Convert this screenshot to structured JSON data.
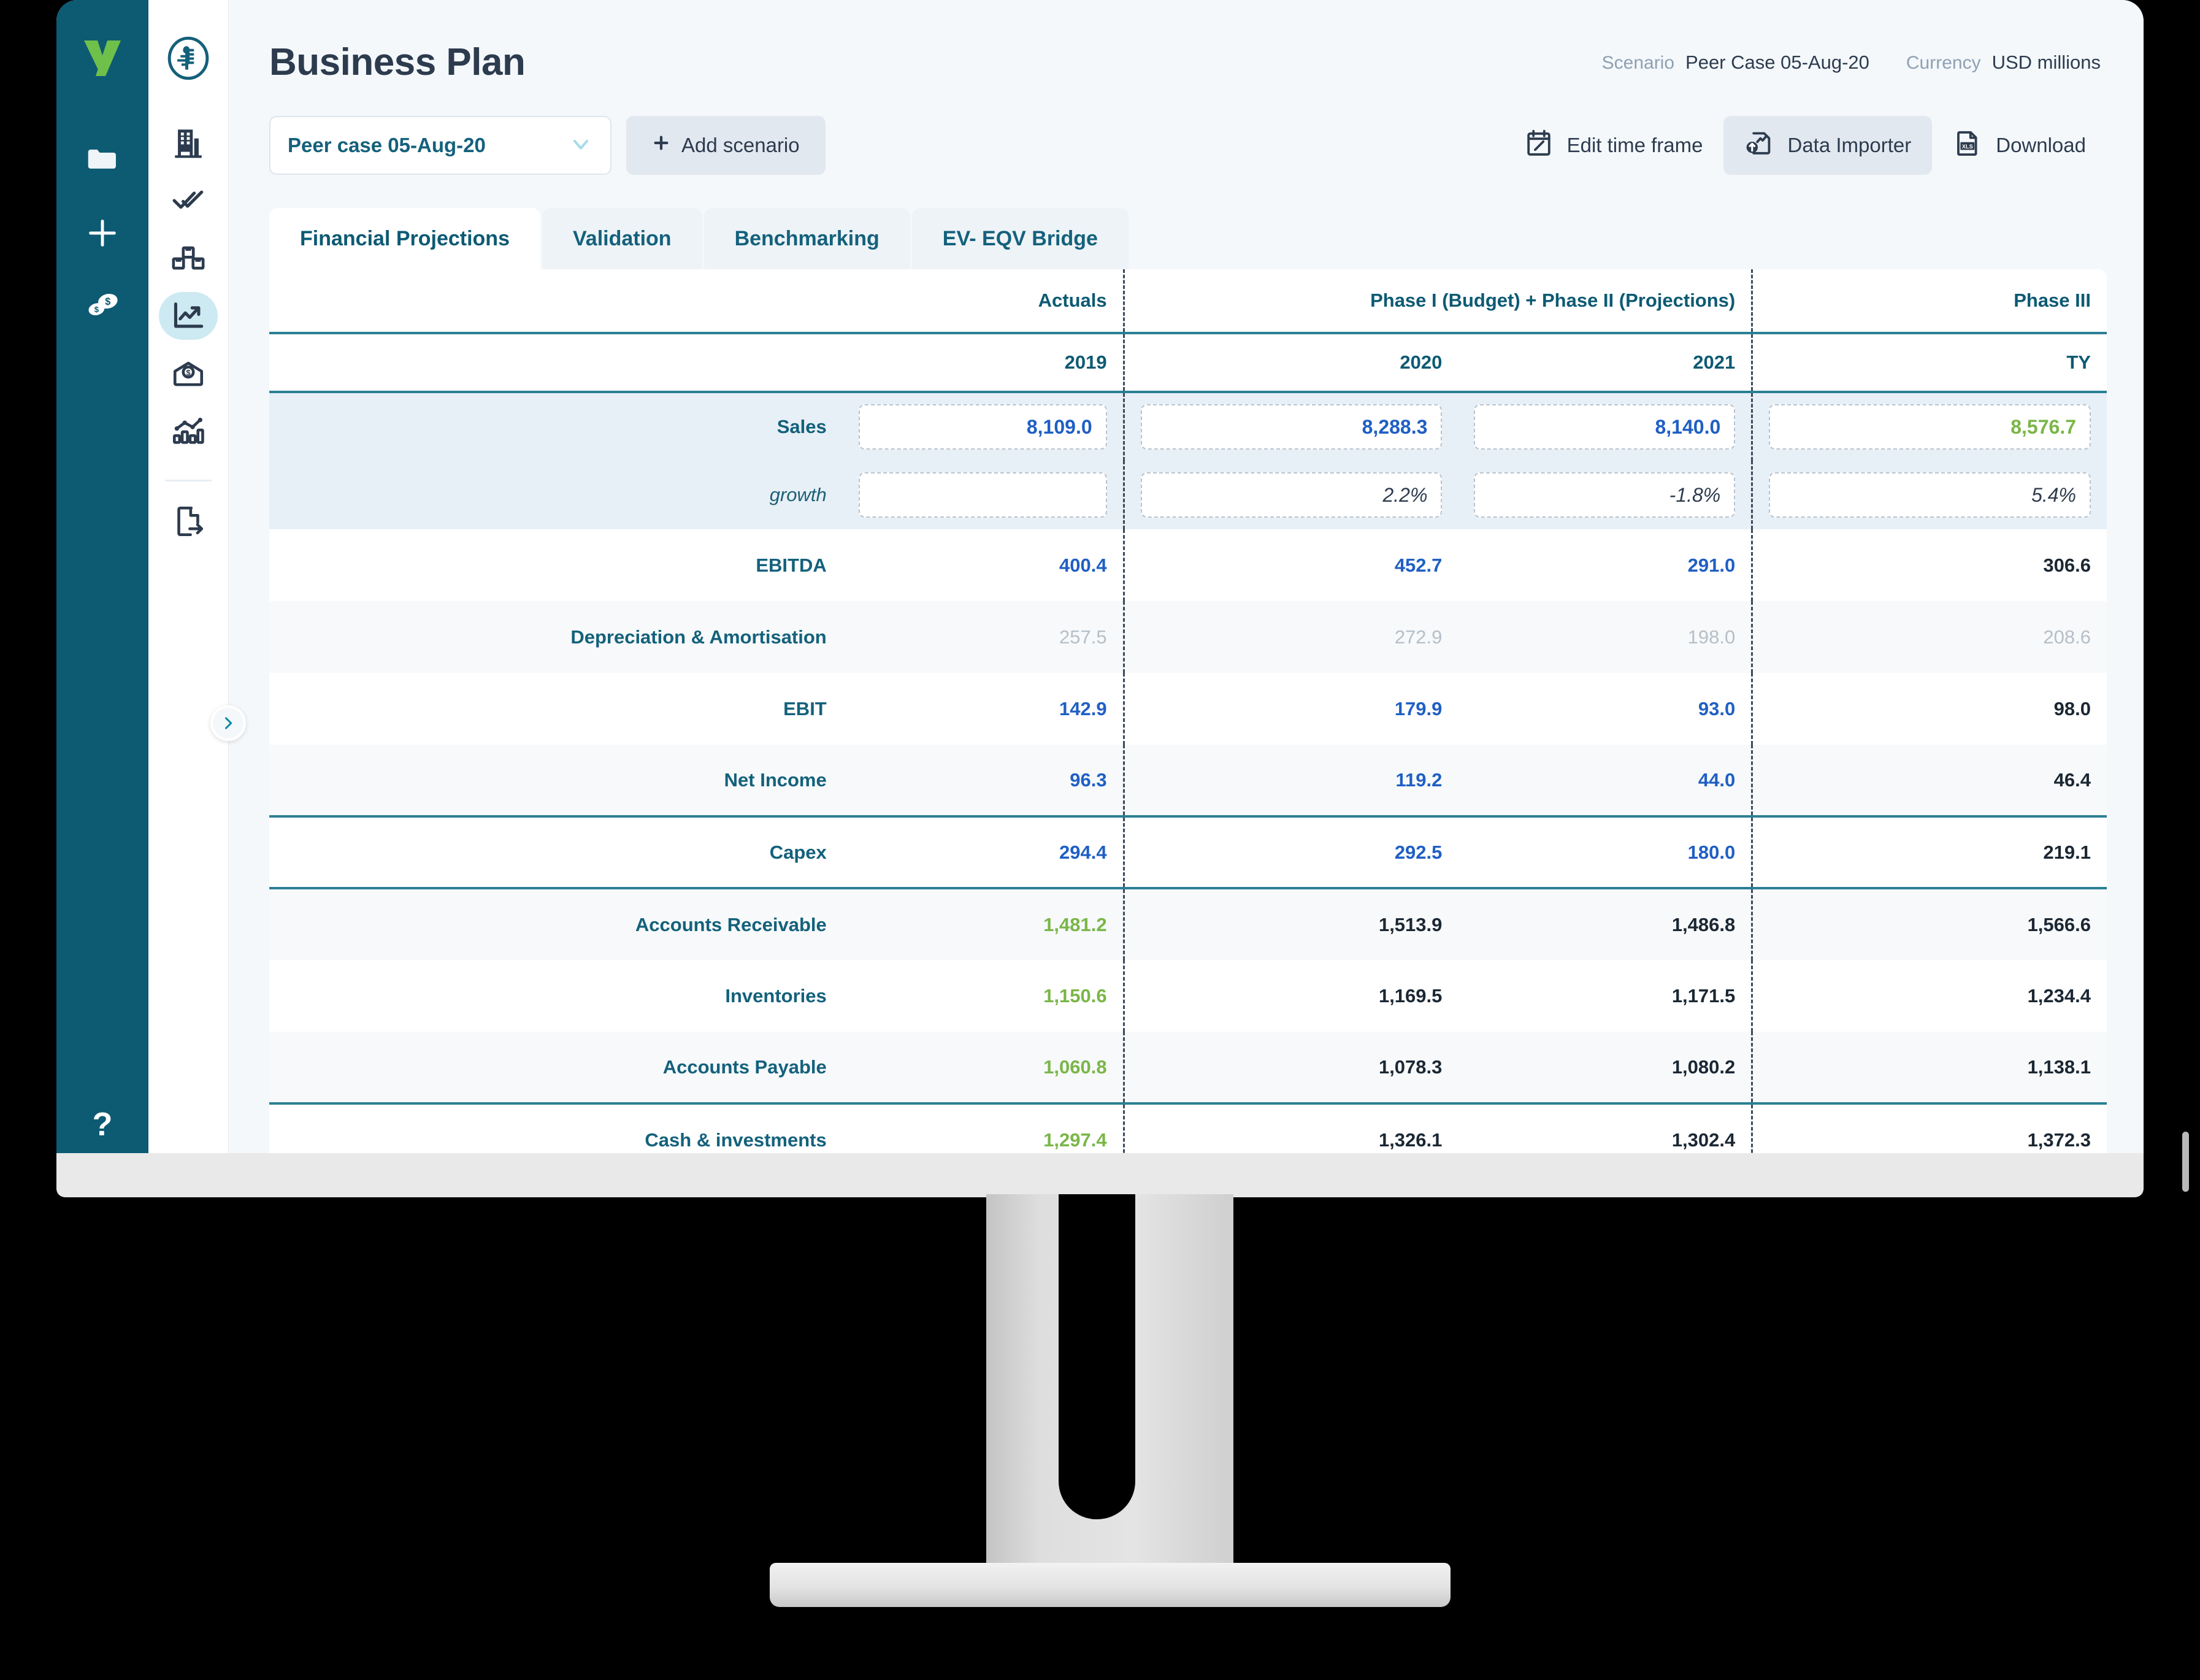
{
  "header": {
    "title": "Business Plan",
    "scenario_label": "Scenario",
    "scenario_value": "Peer Case 05-Aug-20",
    "currency_label": "Currency",
    "currency_value": "USD millions"
  },
  "toolbar": {
    "scenario_select_value": "Peer case 05-Aug-20",
    "add_scenario_label": "Add scenario",
    "edit_time_frame_label": "Edit time frame",
    "data_importer_label": "Data Importer",
    "download_label": "Download"
  },
  "tabs": [
    {
      "label": "Financial Projections",
      "active": true
    },
    {
      "label": "Validation",
      "active": false
    },
    {
      "label": "Benchmarking",
      "active": false
    },
    {
      "label": "EV- EQV Bridge",
      "active": false
    }
  ],
  "sidebar_dark": {
    "logo": "logo-v",
    "items": [
      {
        "icon": "folder-icon"
      },
      {
        "icon": "plus-icon"
      },
      {
        "icon": "coins-icon"
      }
    ],
    "help": "?"
  },
  "sidebar_light": {
    "logo": "circle-badge-logo",
    "items": [
      {
        "icon": "building-icon",
        "active": false
      },
      {
        "icon": "double-check-icon",
        "active": false
      },
      {
        "icon": "boxes-icon",
        "active": false
      },
      {
        "icon": "chart-line-up-icon",
        "active": true
      },
      {
        "icon": "money-envelope-icon",
        "active": false
      },
      {
        "icon": "bar-chart-icon",
        "active": false
      },
      {
        "icon": "export-document-icon",
        "active": false
      }
    ],
    "expand_toggle": "chevron-right-icon"
  },
  "table": {
    "group_headers": [
      {
        "label": "",
        "span": 1
      },
      {
        "label": "Actuals",
        "span": 1
      },
      {
        "label": "Phase I (Budget) + Phase II (Projections)",
        "span": 2
      },
      {
        "label": "Phase III",
        "span": 1
      }
    ],
    "year_headers": [
      "",
      "2019",
      "2020",
      "2021",
      "TY"
    ],
    "rows": [
      {
        "label": "Sales",
        "style": "band-input",
        "cells": [
          {
            "text": "8,109.0",
            "color": "blue",
            "boxed": true
          },
          {
            "text": "8,288.3",
            "color": "blue",
            "boxed": true
          },
          {
            "text": "8,140.0",
            "color": "blue",
            "boxed": true
          },
          {
            "text": "8,576.7",
            "color": "green",
            "boxed": true
          }
        ]
      },
      {
        "label": "growth",
        "style": "band-input-sub",
        "cells": [
          {
            "text": "",
            "color": "ital",
            "boxed": true
          },
          {
            "text": "2.2%",
            "color": "ital",
            "boxed": true
          },
          {
            "text": "-1.8%",
            "color": "ital",
            "boxed": true
          },
          {
            "text": "5.4%",
            "color": "ital",
            "boxed": true
          }
        ]
      },
      {
        "label": "EBITDA",
        "style": "plain",
        "cells": [
          {
            "text": "400.4",
            "color": "blue"
          },
          {
            "text": "452.7",
            "color": "blue"
          },
          {
            "text": "291.0",
            "color": "blue"
          },
          {
            "text": "306.6",
            "color": "dark"
          }
        ]
      },
      {
        "label": "Depreciation & Amortisation",
        "style": "zebra",
        "cells": [
          {
            "text": "257.5",
            "color": "grey"
          },
          {
            "text": "272.9",
            "color": "grey"
          },
          {
            "text": "198.0",
            "color": "grey"
          },
          {
            "text": "208.6",
            "color": "grey"
          }
        ]
      },
      {
        "label": "EBIT",
        "style": "plain",
        "cells": [
          {
            "text": "142.9",
            "color": "blue"
          },
          {
            "text": "179.9",
            "color": "blue"
          },
          {
            "text": "93.0",
            "color": "blue"
          },
          {
            "text": "98.0",
            "color": "dark"
          }
        ]
      },
      {
        "label": "Net Income",
        "style": "zebra",
        "cells": [
          {
            "text": "96.3",
            "color": "blue"
          },
          {
            "text": "119.2",
            "color": "blue"
          },
          {
            "text": "44.0",
            "color": "blue"
          },
          {
            "text": "46.4",
            "color": "dark"
          }
        ]
      },
      {
        "label": "Capex",
        "style": "plain-thick",
        "cells": [
          {
            "text": "294.4",
            "color": "blue"
          },
          {
            "text": "292.5",
            "color": "blue"
          },
          {
            "text": "180.0",
            "color": "blue"
          },
          {
            "text": "219.1",
            "color": "dark"
          }
        ]
      },
      {
        "label": "Accounts Receivable",
        "style": "zebra-thick",
        "cells": [
          {
            "text": "1,481.2",
            "color": "green"
          },
          {
            "text": "1,513.9",
            "color": "dark"
          },
          {
            "text": "1,486.8",
            "color": "dark"
          },
          {
            "text": "1,566.6",
            "color": "dark"
          }
        ]
      },
      {
        "label": "Inventories",
        "style": "plain",
        "cells": [
          {
            "text": "1,150.6",
            "color": "green"
          },
          {
            "text": "1,169.5",
            "color": "dark"
          },
          {
            "text": "1,171.5",
            "color": "dark"
          },
          {
            "text": "1,234.4",
            "color": "dark"
          }
        ]
      },
      {
        "label": "Accounts Payable",
        "style": "zebra",
        "cells": [
          {
            "text": "1,060.8",
            "color": "green"
          },
          {
            "text": "1,078.3",
            "color": "dark"
          },
          {
            "text": "1,080.2",
            "color": "dark"
          },
          {
            "text": "1,138.1",
            "color": "dark"
          }
        ]
      },
      {
        "label": "Cash & investments",
        "style": "plain-thick",
        "cells": [
          {
            "text": "1,297.4",
            "color": "green"
          },
          {
            "text": "1,326.1",
            "color": "dark"
          },
          {
            "text": "1,302.4",
            "color": "dark"
          },
          {
            "text": "1,372.3",
            "color": "dark"
          }
        ]
      },
      {
        "label": "",
        "style": "zebra",
        "cells": [
          {
            "text": "",
            "color": "dark"
          },
          {
            "text": "",
            "color": "dark"
          },
          {
            "text": "",
            "color": "dark"
          },
          {
            "text": "",
            "color": "dark"
          }
        ]
      }
    ]
  },
  "colors": {
    "brand_teal": "#0d5a73",
    "brand_green": "#7ab648",
    "value_blue": "#1f5fc4",
    "accent_light": "#cdeaf2",
    "band": "#e8f0f7"
  }
}
